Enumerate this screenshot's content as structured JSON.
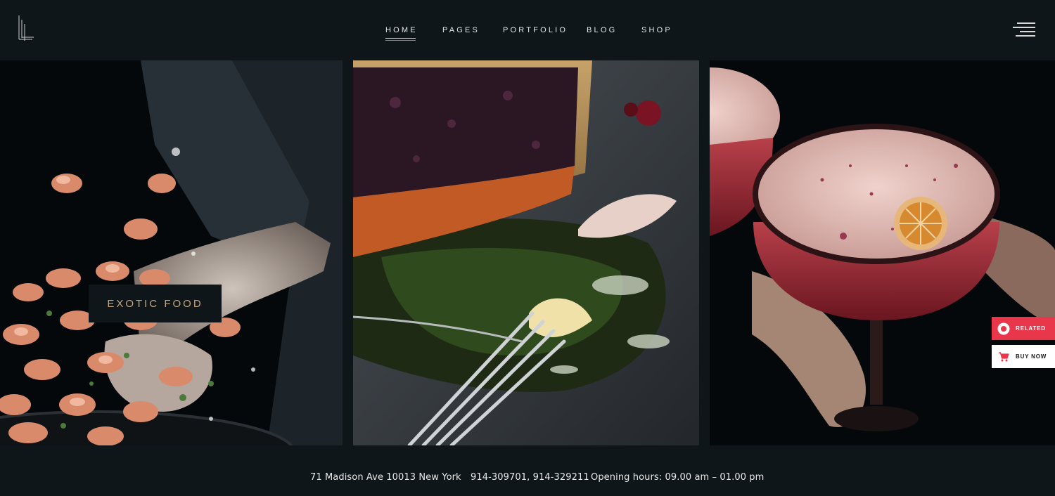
{
  "brand": {
    "logo_icon": "lines-logo-icon"
  },
  "nav": {
    "items": [
      {
        "label": "HOME",
        "active": true
      },
      {
        "label": "PAGES",
        "active": false
      },
      {
        "label": "PORTFOLIO",
        "active": false
      },
      {
        "label": "BLOG",
        "active": false
      },
      {
        "label": "SHOP",
        "active": false
      }
    ],
    "menu_icon": "hamburger-menu-icon"
  },
  "gallery": {
    "panels": [
      {
        "name": "shrimp-photo",
        "caption": "EXOTIC FOOD"
      },
      {
        "name": "pie-photo"
      },
      {
        "name": "cocktail-photo"
      }
    ]
  },
  "side_buttons": {
    "related": {
      "label": "RELATED",
      "icon": "circle-dot-icon",
      "color": "#e8374b"
    },
    "buy_now": {
      "label": "BUY NOW",
      "icon": "cart-icon",
      "color": "#e8374b"
    }
  },
  "footer": {
    "address": "71 Madison Ave 10013 New York",
    "phones": "914-309701, 914-329211",
    "hours": "Opening hours: 09.00 am – 01.00 pm"
  },
  "colors": {
    "background": "#0f1619",
    "accent_gold": "#c6a57a",
    "accent_red": "#e8374b"
  }
}
